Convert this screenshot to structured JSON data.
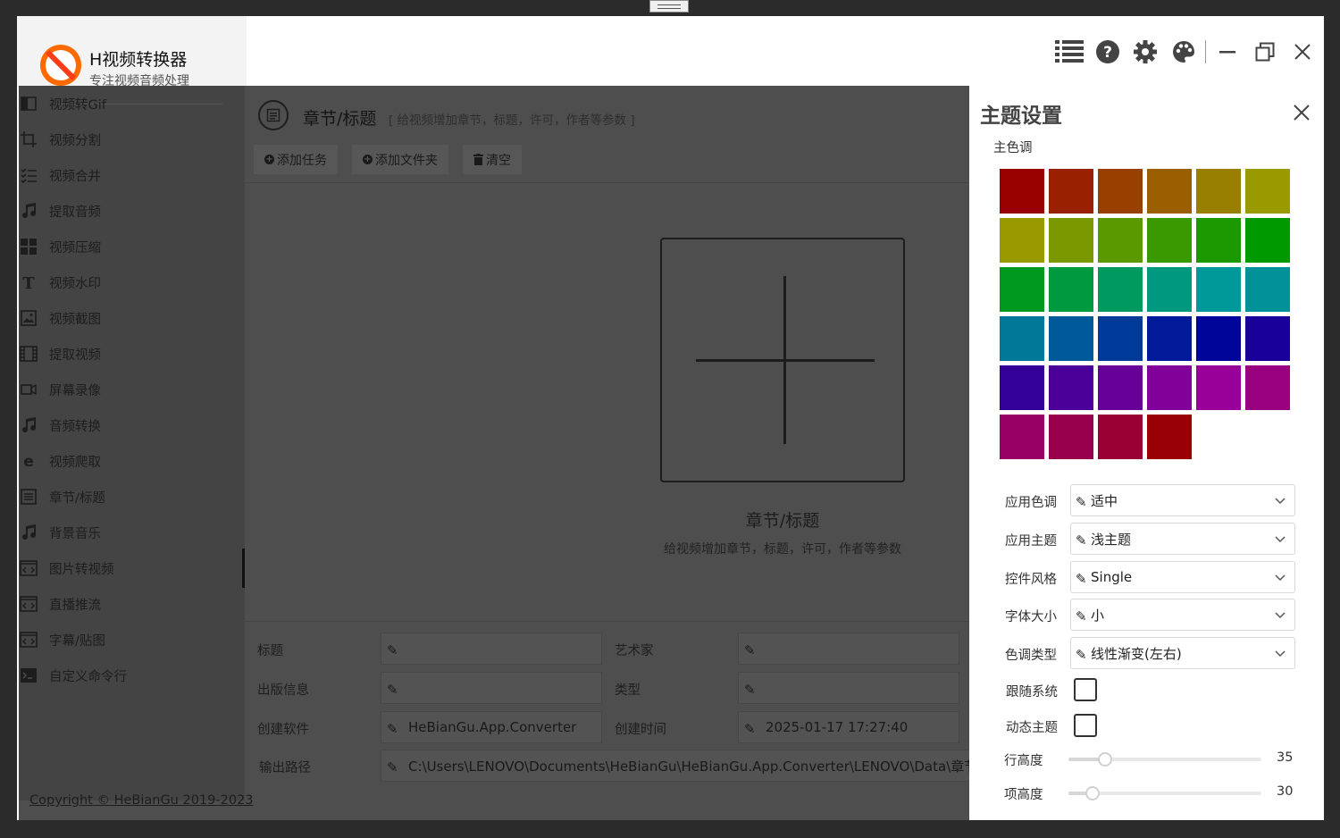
{
  "app": {
    "title": "H视频转换器",
    "subtitle": "专注视频音频处理"
  },
  "titlebar_icons": [
    "list-icon",
    "help-icon",
    "gear-icon",
    "palette-icon",
    "minimize-icon",
    "restore-icon",
    "close-icon"
  ],
  "sidebar": {
    "items": [
      {
        "label": "视频转Gif",
        "icon": "gif-icon"
      },
      {
        "label": "视频分割",
        "icon": "crop-icon"
      },
      {
        "label": "视频合并",
        "icon": "list-check-icon"
      },
      {
        "label": "提取音频",
        "icon": "music-note-icon"
      },
      {
        "label": "视频压缩",
        "icon": "grid-icon"
      },
      {
        "label": "视频水印",
        "icon": "text-t-icon"
      },
      {
        "label": "视频截图",
        "icon": "image-icon"
      },
      {
        "label": "提取视频",
        "icon": "film-icon"
      },
      {
        "label": "屏幕录像",
        "icon": "camera-icon"
      },
      {
        "label": "音频转换",
        "icon": "music-note-icon"
      },
      {
        "label": "视频爬取",
        "icon": "browser-e-icon"
      },
      {
        "label": "章节/标题",
        "icon": "document-icon"
      },
      {
        "label": "背景音乐",
        "icon": "music-note-icon"
      },
      {
        "label": "图片转视频",
        "icon": "code-window-icon"
      },
      {
        "label": "直播推流",
        "icon": "code-window-icon"
      },
      {
        "label": "字幕/贴图",
        "icon": "code-window-icon"
      },
      {
        "label": "自定义命令行",
        "icon": "terminal-icon"
      }
    ],
    "active_index": 11
  },
  "page": {
    "title": "章节/标题",
    "description": "[ 给视频增加章节，标题，许可，作者等参数 ]"
  },
  "toolbar": {
    "add_task": "添加任务",
    "add_folder": "添加文件夹",
    "clear": "清空"
  },
  "dropzone": {
    "title": "章节/标题",
    "description": "给视频增加章节，标题，许可，作者等参数"
  },
  "metadata": {
    "title_label": "标题",
    "title_value": "",
    "artist_label": "艺术家",
    "artist_value": "",
    "publisher_label": "出版信息",
    "publisher_value": "",
    "genre_label": "类型",
    "genre_value": "",
    "software_label": "创建软件",
    "software_value": "HeBianGu.App.Converter",
    "created_label": "创建时间",
    "created_value": "2025-01-17 17:27:40",
    "output_label": "输出路径",
    "output_value": "C:\\Users\\LENOVO\\Documents\\HeBianGu\\HeBianGu.App.Converter\\LENOVO\\Data\\章节/标"
  },
  "copyright": "Copyright © HeBianGu 2019-2023",
  "theme_panel": {
    "title": "主题设置",
    "palette_label": "主色调",
    "palette": [
      "#990000",
      "#992000",
      "#993f00",
      "#995f00",
      "#997f00",
      "#999900",
      "#999900",
      "#7a9900",
      "#5b9900",
      "#3b9900",
      "#1c9900",
      "#009900",
      "#009920",
      "#00993f",
      "#00995f",
      "#00997f",
      "#009999",
      "#009199",
      "#007999",
      "#005999",
      "#003a99",
      "#001a99",
      "#000599",
      "#190099",
      "#330099",
      "#4a0099",
      "#660099",
      "#800099",
      "#990099",
      "#990080",
      "#990066",
      "#99004c",
      "#990033",
      "#990005"
    ],
    "fields": [
      {
        "label": "应用色调",
        "value": "适中"
      },
      {
        "label": "应用主题",
        "value": "浅主题"
      },
      {
        "label": "控件风格",
        "value": "Single"
      },
      {
        "label": "字体大小",
        "value": "小"
      },
      {
        "label": "色调类型",
        "value": "线性渐变(左右)"
      }
    ],
    "follow_system": {
      "label": "跟随系统",
      "checked": false
    },
    "dynamic_theme": {
      "label": "动态主题",
      "checked": false
    },
    "row_height": {
      "label": "行高度",
      "value": 35,
      "min": 20,
      "max": 100
    },
    "item_height": {
      "label": "项高度",
      "value": 30,
      "min": 20,
      "max": 100
    }
  }
}
